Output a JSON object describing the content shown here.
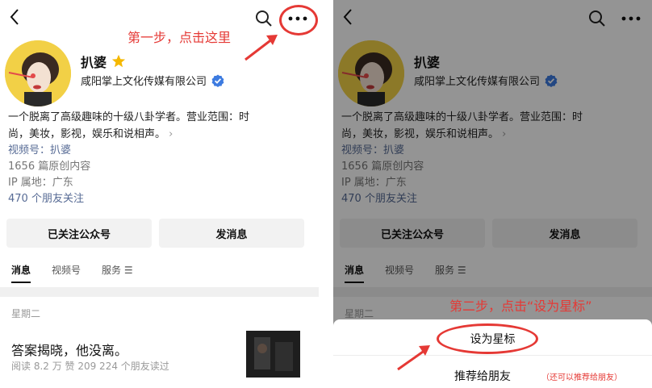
{
  "left": {
    "annotation": "第一步，点击这里",
    "profile": {
      "name": "扒婆",
      "company": "咸阳掌上文化传媒有限公司"
    },
    "bio": {
      "line1": "一个脱离了高级趣味的十级八卦学者。营业范围：时",
      "line2": "尚，美妆，影视，娱乐和说相声。",
      "more_arrow": "›"
    },
    "meta": {
      "channel": "视频号：扒婆",
      "articles": "1656 篇原创内容",
      "ip": "IP 属地：广东",
      "friends": "470 个朋友关注"
    },
    "buttons": {
      "follow": "已关注公众号",
      "message": "发消息"
    },
    "tabs": [
      "消息",
      "视频号",
      "服务 ☰"
    ],
    "feed": {
      "day": "星期二",
      "title": "答案揭晓，他没离。",
      "meta": "阅读 8.2 万   赞 209   224 个朋友读过"
    }
  },
  "right": {
    "annotation": "第二步，点击“设为星标”",
    "profile": {
      "name": "扒婆",
      "company": "咸阳掌上文化传媒有限公司"
    },
    "bio": {
      "line1": "一个脱离了高级趣味的十级八卦学者。营业范围：时",
      "line2": "尚，美妆，影视，娱乐和说相声。",
      "more_arrow": "›"
    },
    "meta": {
      "channel": "视频号：扒婆",
      "articles": "1656 篇原创内容",
      "ip": "IP 属地：广东",
      "friends": "470 个朋友关注"
    },
    "buttons": {
      "follow": "已关注公众号",
      "message": "发消息"
    },
    "tabs": [
      "消息",
      "视频号",
      "服务 ☰"
    ],
    "feed": {
      "day": "星期二"
    },
    "sheet": {
      "star": "设为星标",
      "recommend": "推荐给朋友",
      "recommend_note": "（还可以推荐给朋友）"
    }
  },
  "colors": {
    "annotation_red": "#e53935",
    "link_blue": "#576b95",
    "verify_blue": "#3d7be0",
    "star_gold": "#f5b800"
  },
  "icons": [
    "back-icon",
    "search-icon",
    "more-icon",
    "star-icon",
    "verified-icon",
    "arrow-icon"
  ]
}
